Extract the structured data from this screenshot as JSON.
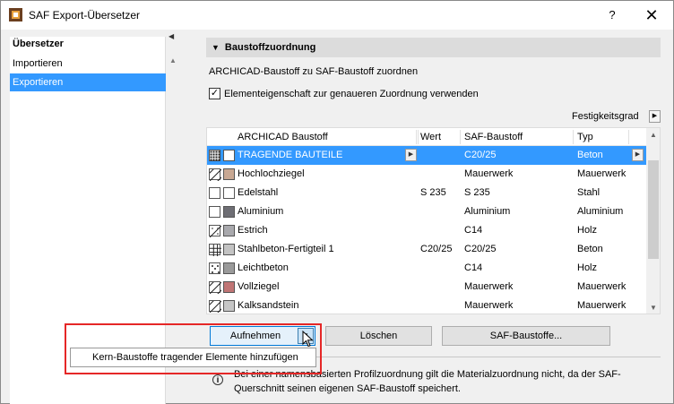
{
  "window": {
    "title": "SAF Export-Übersetzer",
    "help": "?",
    "close": "✕"
  },
  "nav": {
    "header": "Übersetzer",
    "items": [
      {
        "label": "Importieren"
      },
      {
        "label": "Exportieren"
      }
    ]
  },
  "section": {
    "title": "Baustoffzuordnung"
  },
  "assign_label": "ARCHICAD-Baustoff zu SAF-Baustoff zuordnen",
  "checkbox": {
    "label": "Elementeigenschaft zur genaueren Zuordnung verwenden",
    "checked": true
  },
  "festigkeitsgrad": "Festigkeitsgrad",
  "table": {
    "columns": [
      "ARCHICAD Baustoff",
      "Wert",
      "SAF-Baustoff",
      "Typ"
    ],
    "rows": [
      {
        "name": "TRAGENDE BAUTEILE",
        "wert": "",
        "saf": "C20/25",
        "typ": "Beton",
        "color": "#ffffff",
        "pattern": "dots"
      },
      {
        "name": "Hochlochziegel",
        "wert": "",
        "saf": "Mauerwerk",
        "typ": "Mauerwerk",
        "color": "#c8a893",
        "pattern": "hatch"
      },
      {
        "name": "Edelstahl",
        "wert": "S 235",
        "saf": "S 235",
        "typ": "Stahl",
        "color": "#ffffff",
        "pattern": "none"
      },
      {
        "name": "Aluminium",
        "wert": "",
        "saf": "Aluminium",
        "typ": "Aluminium",
        "color": "#6e6e74",
        "pattern": "none"
      },
      {
        "name": "Estrich",
        "wert": "",
        "saf": "C14",
        "typ": "Holz",
        "color": "#a9a9ad",
        "pattern": "dothatch"
      },
      {
        "name": "Stahlbeton-Fertigteil 1",
        "wert": "C20/25",
        "saf": "C20/25",
        "typ": "Beton",
        "color": "#c3c3c3",
        "pattern": "grid"
      },
      {
        "name": "Leichtbeton",
        "wert": "",
        "saf": "C14",
        "typ": "Holz",
        "color": "#9a9a9a",
        "pattern": "dotted"
      },
      {
        "name": "Vollziegel",
        "wert": "",
        "saf": "Mauerwerk",
        "typ": "Mauerwerk",
        "color": "#c07575",
        "pattern": "hatch"
      },
      {
        "name": "Kalksandstein",
        "wert": "",
        "saf": "Mauerwerk",
        "typ": "Mauerwerk",
        "color": "#c6c6c6",
        "pattern": "hatch"
      }
    ]
  },
  "buttons": {
    "aufnehmen": "Aufnehmen",
    "loeschen": "Löschen",
    "saf_baustoffe": "SAF-Baustoffe..."
  },
  "popup": {
    "label": "Kern-Baustoffe tragender Elemente hinzufügen"
  },
  "info": {
    "text": "Bei einer namensbasierten Profilzuordnung gilt die Materialzuordnung nicht, da der SAF-Querschnitt seinen eigenen SAF-Baustoff speichert."
  },
  "colors": {
    "selection": "#3399ff",
    "highlight_frame": "#e52727"
  }
}
